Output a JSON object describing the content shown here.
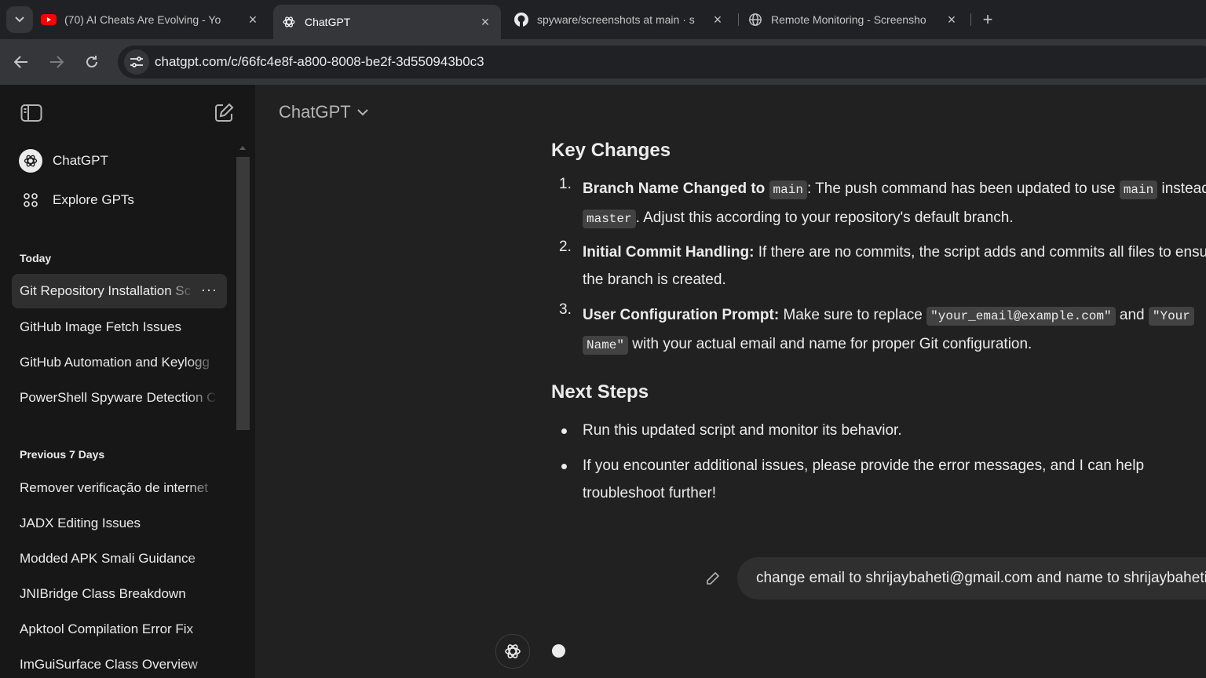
{
  "browser": {
    "tabs": [
      {
        "title": "(70) AI Cheats Are Evolving - Yo",
        "icon": "youtube-icon",
        "active": false
      },
      {
        "title": "ChatGPT",
        "icon": "chatgpt-icon",
        "active": true
      },
      {
        "title": "spyware/screenshots at main · s",
        "icon": "github-icon",
        "active": false
      },
      {
        "title": "Remote Monitoring - Screensho",
        "icon": "globe-icon",
        "active": false
      }
    ],
    "url": "chatgpt.com/c/66fc4e8f-a800-8008-be2f-3d550943b0c3"
  },
  "sidebar": {
    "top_items": [
      {
        "label": "ChatGPT",
        "icon": "chatgpt-icon"
      },
      {
        "label": "Explore GPTs",
        "icon": "grid-icon"
      }
    ],
    "sections": [
      {
        "heading": "Today",
        "items": [
          "Git Repository Installation Sc",
          "GitHub Image Fetch Issues",
          "GitHub Automation and Keylogg",
          "PowerShell Spyware Detection C"
        ]
      },
      {
        "heading": "Previous 7 Days",
        "items": [
          "Remover verificação de internet",
          "JADX Editing Issues",
          "Modded APK Smali Guidance",
          "JNIBridge Class Breakdown",
          "Apktool Compilation Error Fix",
          "ImGuiSurface Class Overview"
        ]
      }
    ],
    "more_label": "···"
  },
  "main": {
    "model_name": "ChatGPT",
    "key_changes": {
      "heading": "Key Changes",
      "items": [
        {
          "num": "1.",
          "bold": "Branch Name Changed to",
          "code1": "main",
          "text1": ": The push command has been updated to use",
          "code2": "main",
          "text2": "instead of",
          "code3": "master",
          "text3": ". Adjust this according to your repository's default branch."
        },
        {
          "num": "2.",
          "bold": "Initial Commit Handling:",
          "text1": "If there are no commits, the script adds and commits all files to ensure",
          "text2": "the branch is created."
        },
        {
          "num": "3.",
          "bold": "User Configuration Prompt:",
          "text1": "Make sure to replace",
          "code1": "\"your_email@example.com\"",
          "text2": "and",
          "code2": "\"Your",
          "code3": "Name\"",
          "text3": "with your actual email and name for proper Git configuration."
        }
      ]
    },
    "next_steps": {
      "heading": "Next Steps",
      "items": [
        {
          "line1": "Run this updated script and monitor its behavior."
        },
        {
          "line1": "If you encounter additional issues, please provide the error messages, and I can help",
          "line2": "troubleshoot further!"
        }
      ]
    },
    "user_message": "change email to shrijaybaheti@gmail.com and name to shrijaybaheti"
  }
}
